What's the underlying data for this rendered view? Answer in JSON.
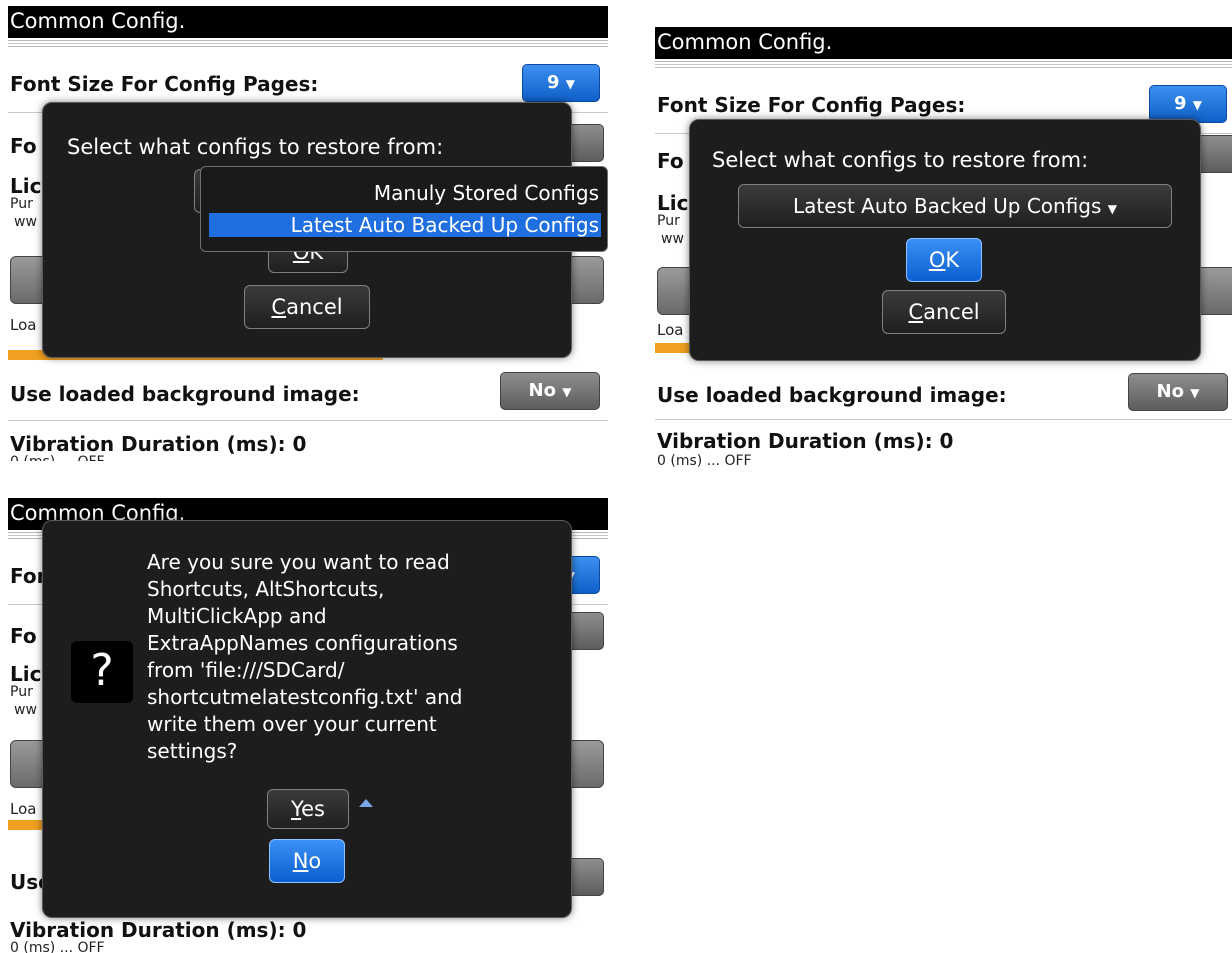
{
  "page": {
    "title": "Common Config.",
    "font_size_label": "Font Size For Config Pages:",
    "font_size_value": "9",
    "font_row2_label": "Fo",
    "license_label": "Lic",
    "license_sub1": "Pur",
    "license_sub2": "ww",
    "load_label": "Loa",
    "bg_image_label": "Use loaded background image:",
    "bg_image_value": "No",
    "vibration_label": "Vibration Duration (ms): 0",
    "vibration_sub": "0 (ms) ... OFF",
    "dropdown_caret": "▼"
  },
  "dialog_restore": {
    "prompt": "Select what configs to restore from:",
    "options": [
      "Manuly Stored Configs",
      "Latest Auto Backed Up Configs"
    ],
    "selected": "Latest Auto Backed Up Configs",
    "ok_mnemonic": "O",
    "ok_rest": "K",
    "cancel_mnemonic": "C",
    "cancel_rest": "ancel"
  },
  "dialog_confirm": {
    "icon": "question-icon",
    "icon_glyph": "?",
    "message_lines": [
      "Are you sure you want to read",
      "Shortcuts, AltShortcuts,",
      "MultiClickApp and",
      "ExtraAppNames configurations",
      "from 'file:///SDCard/",
      "shortcutmelatestconfig.txt' and",
      "write them over your current",
      "settings?"
    ],
    "yes_mnemonic": "Y",
    "yes_rest": "es",
    "no_mnemonic": "N",
    "no_rest": "o"
  },
  "colors": {
    "titlebar": "#000000",
    "dialog_bg": "#1d1d1d",
    "focus_blue": "#1f6fe0",
    "progress_orange": "#f0a020"
  }
}
